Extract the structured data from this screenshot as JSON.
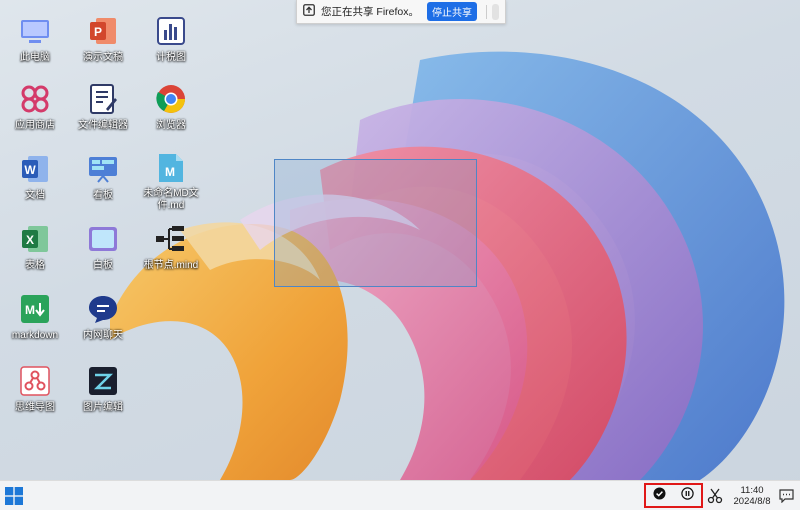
{
  "desktop": {
    "icons": [
      {
        "id": "this-pc",
        "label": "此电脑"
      },
      {
        "id": "presentation",
        "label": "演示文稿"
      },
      {
        "id": "chart",
        "label": "计税图"
      },
      {
        "id": "app-store",
        "label": "应用商店"
      },
      {
        "id": "text-editor",
        "label": "文件编辑器"
      },
      {
        "id": "browser",
        "label": "浏览器"
      },
      {
        "id": "word",
        "label": "文档"
      },
      {
        "id": "whiteboard",
        "label": "看板"
      },
      {
        "id": "md-file",
        "label": "未命名MD文件.md"
      },
      {
        "id": "excel",
        "label": "表格"
      },
      {
        "id": "canvas",
        "label": "白板"
      },
      {
        "id": "mind-map",
        "label": "根节点.mind"
      },
      {
        "id": "markdown",
        "label": "markdown"
      },
      {
        "id": "chat",
        "label": "内网聊天"
      },
      {
        "id": "flowchart",
        "label": "思维导图"
      },
      {
        "id": "image-editor",
        "label": "图片编辑"
      }
    ]
  },
  "share_banner": {
    "message": "您正在共享 Firefox。",
    "stop_label": "停止共享"
  },
  "taskbar": {
    "time": "11:40",
    "date": "2024/8/8"
  },
  "colors": {
    "accent": "#1e6ee6",
    "highlight_border": "#e01818",
    "selection_border": "#4f86c6"
  }
}
